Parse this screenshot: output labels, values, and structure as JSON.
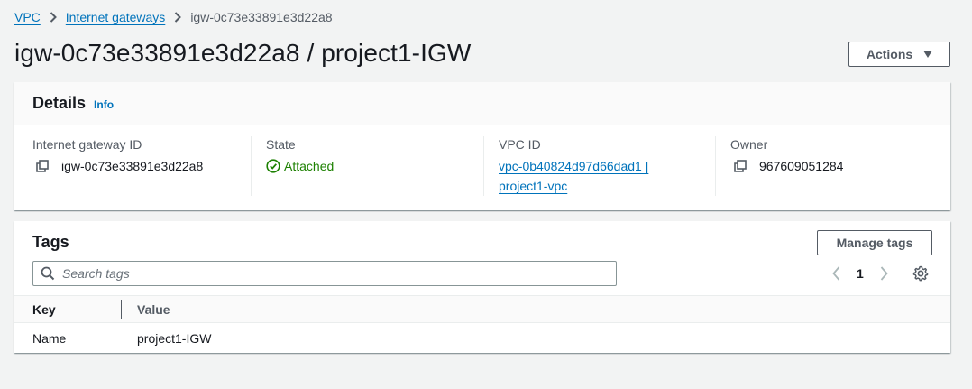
{
  "breadcrumb": {
    "items": [
      "VPC",
      "Internet gateways"
    ],
    "current": "igw-0c73e33891e3d22a8"
  },
  "header": {
    "title": "igw-0c73e33891e3d22a8 / project1-IGW",
    "actions_label": "Actions"
  },
  "details": {
    "heading": "Details",
    "info_label": "Info",
    "gateway_id_label": "Internet gateway ID",
    "gateway_id": "igw-0c73e33891e3d22a8",
    "state_label": "State",
    "state": "Attached",
    "vpc_id_label": "VPC ID",
    "vpc_id_line1": "vpc-0b40824d97d66dad1 |",
    "vpc_id_line2": "project1-vpc",
    "owner_label": "Owner",
    "owner": "967609051284"
  },
  "tags": {
    "heading": "Tags",
    "manage_label": "Manage tags",
    "search_placeholder": "Search tags",
    "page": "1",
    "columns": [
      "Key",
      "Value"
    ],
    "rows": [
      {
        "key": "Name",
        "value": "project1-IGW"
      }
    ]
  },
  "colors": {
    "link": "#0073bb",
    "success": "#1d8102",
    "text": "#16191f",
    "secondary": "#545b64"
  }
}
